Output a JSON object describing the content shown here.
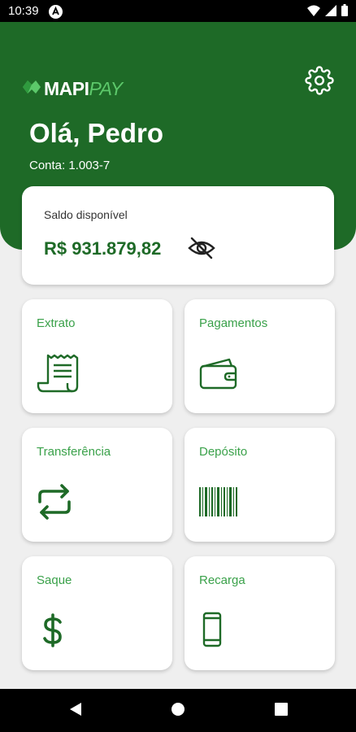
{
  "status_bar": {
    "time": "10:39",
    "icons": [
      "app-notification-icon",
      "wifi-icon",
      "cellular-signal-icon",
      "battery-icon"
    ]
  },
  "header": {
    "logo_mapi": "MAPI",
    "logo_pay": "PAY",
    "greeting": "Olá, Pedro",
    "account": "Conta: 1.003-7",
    "background_color": "#1e6a27"
  },
  "balance": {
    "label": "Saldo disponível",
    "value": "R$ 931.879,82",
    "visibility_icon": "eye-off-icon"
  },
  "tiles": [
    {
      "label": "Extrato",
      "icon": "receipt-icon"
    },
    {
      "label": "Pagamentos",
      "icon": "wallet-icon"
    },
    {
      "label": "Transferência",
      "icon": "transfer-arrows-icon"
    },
    {
      "label": "Depósito",
      "icon": "barcode-icon"
    },
    {
      "label": "Saque",
      "icon": "dollar-icon"
    },
    {
      "label": "Recarga",
      "icon": "smartphone-icon"
    }
  ],
  "nav_bar": {
    "buttons": [
      "back-icon",
      "home-icon",
      "recents-icon"
    ]
  },
  "colors": {
    "brand_green": "#1e6a27",
    "accent_green": "#3aa14a",
    "logo_light_green": "#5cc86a"
  }
}
